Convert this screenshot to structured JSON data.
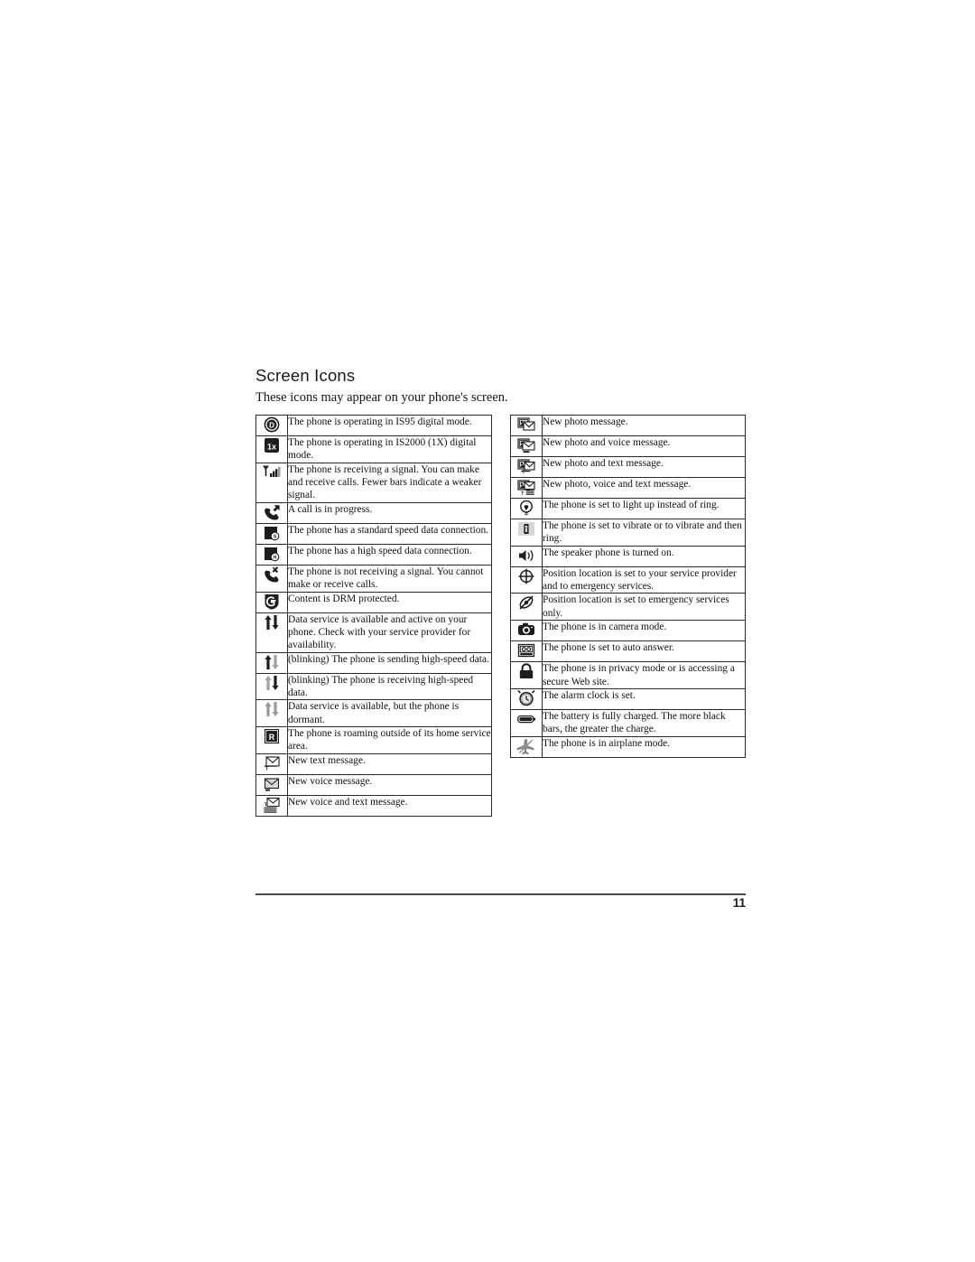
{
  "page": {
    "section_title": "Screen Icons",
    "intro": "These icons may appear on your phone's screen.",
    "folio": "11"
  },
  "left_table": {
    "rows": [
      {
        "icon": "is95-digital-mode-icon",
        "text": "The phone is operating in IS95 digital mode."
      },
      {
        "icon": "is2000-1x-digital-mode-icon",
        "text": "The phone is operating in IS2000 (1X) digital mode."
      },
      {
        "icon": "signal-strength-icon",
        "text": "The phone is receiving a signal. You can make and receive calls. Fewer bars indicate a weaker signal."
      },
      {
        "icon": "call-in-progress-icon",
        "text": "A call is in progress."
      },
      {
        "icon": "standard-speed-data-icon",
        "text": "The phone has a standard speed data connection."
      },
      {
        "icon": "high-speed-data-icon",
        "text": "The phone has a high speed data connection."
      },
      {
        "icon": "no-signal-icon",
        "text": "The phone is not receiving a signal. You cannot make or receive calls."
      },
      {
        "icon": "drm-protected-icon",
        "text": "Content is DRM protected."
      },
      {
        "icon": "data-active-icon",
        "text": "Data service is available and active on your phone. Check with your service provider for availability."
      },
      {
        "icon": "data-sending-icon",
        "text": "(blinking) The phone is sending high-speed data."
      },
      {
        "icon": "data-receiving-icon",
        "text": "(blinking) The phone is receiving high-speed data."
      },
      {
        "icon": "data-dormant-icon",
        "text": "Data service is available, but the phone is dormant."
      },
      {
        "icon": "roaming-icon",
        "text": "The phone is roaming outside of its home service area."
      },
      {
        "icon": "new-text-message-icon",
        "text": "New text message."
      },
      {
        "icon": "new-voice-message-icon",
        "text": "New voice message."
      },
      {
        "icon": "new-voice-and-text-message-icon",
        "text": "New voice and text message."
      }
    ]
  },
  "right_table": {
    "rows": [
      {
        "icon": "new-photo-message-icon",
        "text": "New photo message."
      },
      {
        "icon": "new-photo-and-voice-message-icon",
        "text": "New photo and voice message."
      },
      {
        "icon": "new-photo-and-text-message-icon",
        "text": "New photo and text message."
      },
      {
        "icon": "new-photo-voice-and-text-message-icon",
        "text": "New photo, voice and text message."
      },
      {
        "icon": "light-up-instead-of-ring-icon",
        "text": "The phone is set to light up instead of ring."
      },
      {
        "icon": "vibrate-icon",
        "text": "The phone is set to vibrate or to vibrate and then ring."
      },
      {
        "icon": "speaker-phone-icon",
        "text": "The speaker phone is turned on."
      },
      {
        "icon": "position-location-on-icon",
        "text": "Position location is set to your service provider and to emergency services."
      },
      {
        "icon": "position-location-emergency-only-icon",
        "text": "Position location is set to emergency services only."
      },
      {
        "icon": "camera-mode-icon",
        "text": "The phone is in camera mode."
      },
      {
        "icon": "auto-answer-icon",
        "text": "The phone is set to auto answer."
      },
      {
        "icon": "privacy-lock-icon",
        "text": "The phone is in privacy mode or is accessing a secure Web site."
      },
      {
        "icon": "alarm-clock-icon",
        "text": "The alarm clock is set."
      },
      {
        "icon": "battery-full-icon",
        "text": "The battery is fully charged. The more black bars, the greater the charge."
      },
      {
        "icon": "airplane-mode-icon",
        "text": "The phone is in airplane mode."
      }
    ]
  }
}
